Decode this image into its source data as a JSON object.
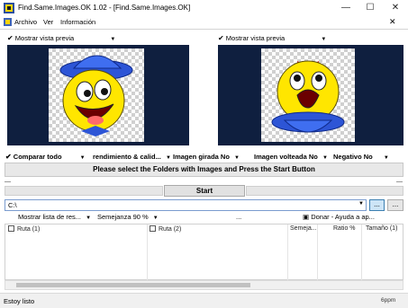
{
  "window": {
    "title": "Find.Same.Images.OK 1.02 - [Find.Same.Images.OK]",
    "minimize": "—",
    "maximize": "☐",
    "close": "✕"
  },
  "menu": {
    "items": [
      "Archivo",
      "Ver",
      "Información"
    ],
    "right_close": "✕"
  },
  "preview": {
    "left_toggle": "Mostrar vista previa",
    "right_toggle": "Mostrar vista previa"
  },
  "options": {
    "compare": "Comparar todo",
    "performance": "rendimiento & calid...",
    "rotated": "Imagen girada No",
    "flipped": "Imagen volteada No",
    "negative": "Negativo No"
  },
  "banner": "Please select the Folders with Images and Press the Start Button",
  "start_label": "Start",
  "progress_left_tick": "—",
  "progress_right_tick": "—",
  "path": {
    "value": "C:\\",
    "browse": "...",
    "extra": "..."
  },
  "results_toolbar": {
    "show_list": "Mostrar lista de res...",
    "similarity": "Semejanza 90 %",
    "ellipsis": "...",
    "donate": "Donar - Ayuda a ap..."
  },
  "table": {
    "columns": [
      "Ruta (1)",
      "Ruta (2)",
      "Semeja...",
      "Ratio %",
      "Tamaño (1)"
    ]
  },
  "status": {
    "text": "Estoy listo",
    "right": "6ppm"
  }
}
